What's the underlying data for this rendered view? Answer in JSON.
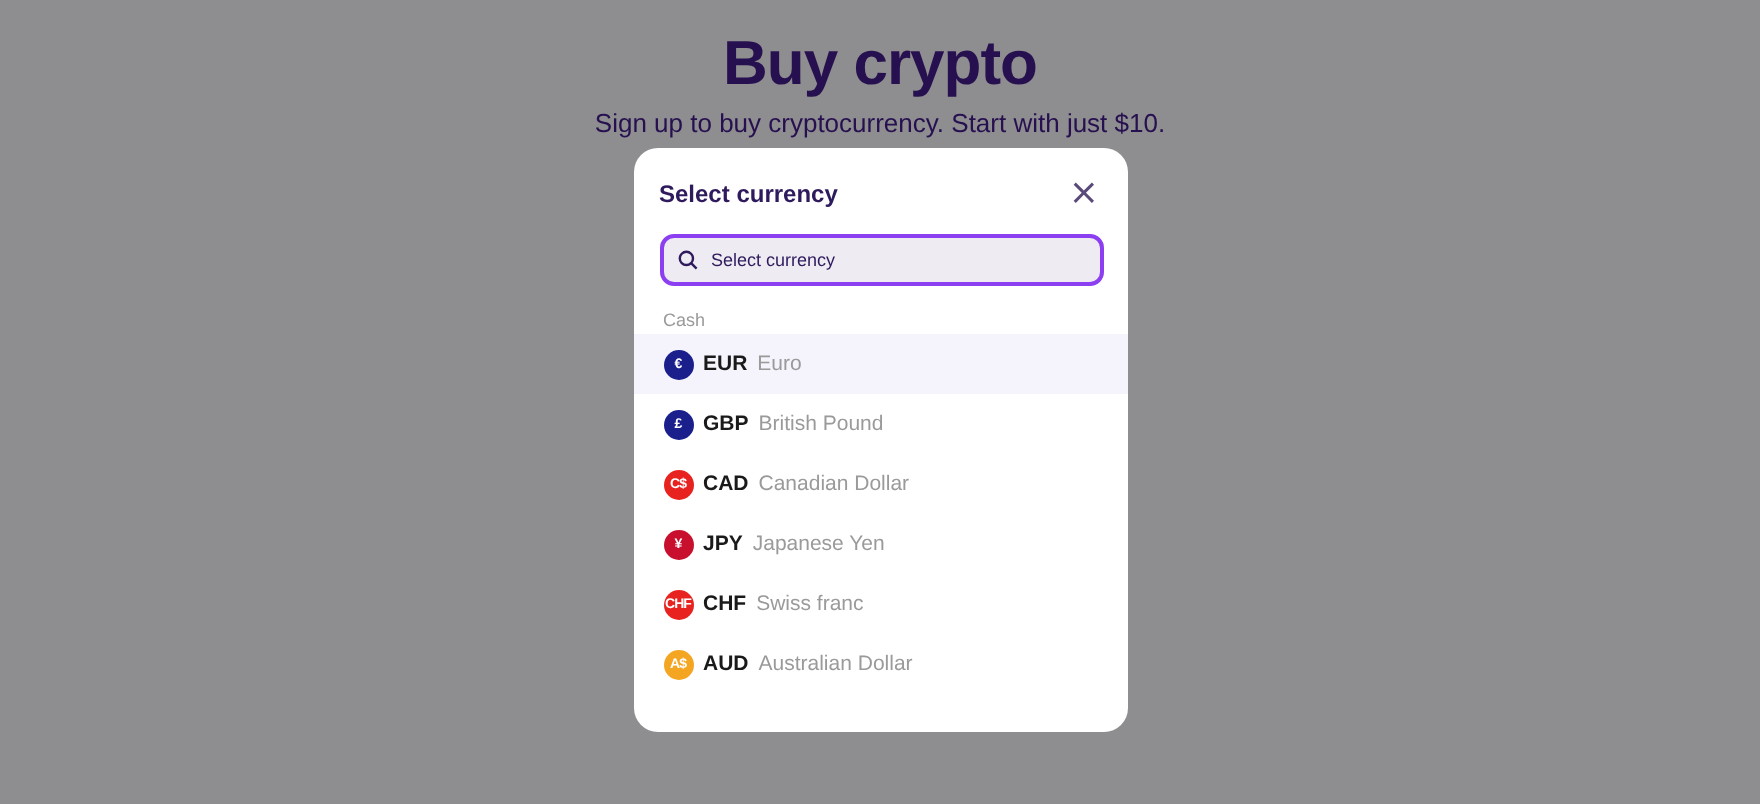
{
  "page": {
    "title": "Buy crypto",
    "subtitle": "Sign up to buy cryptocurrency. Start with just $10."
  },
  "dialog": {
    "title": "Select currency",
    "close": "×",
    "search": {
      "placeholder": "Select currency"
    },
    "section": "Cash",
    "items": [
      {
        "code": "EUR",
        "name": "Euro",
        "symbol": "€",
        "color": "#1a1f8c",
        "selected": true
      },
      {
        "code": "GBP",
        "name": "British Pound",
        "symbol": "£",
        "color": "#1a1f8c",
        "selected": false
      },
      {
        "code": "CAD",
        "name": "Canadian Dollar",
        "symbol": "C$",
        "color": "#e8231f",
        "selected": false
      },
      {
        "code": "JPY",
        "name": "Japanese Yen",
        "symbol": "¥",
        "color": "#c8102e",
        "selected": false
      },
      {
        "code": "CHF",
        "name": "Swiss franc",
        "symbol": "CHF",
        "color": "#e8231f",
        "selected": false
      },
      {
        "code": "AUD",
        "name": "Australian Dollar",
        "symbol": "A$",
        "color": "#f4a623",
        "selected": false
      }
    ]
  }
}
